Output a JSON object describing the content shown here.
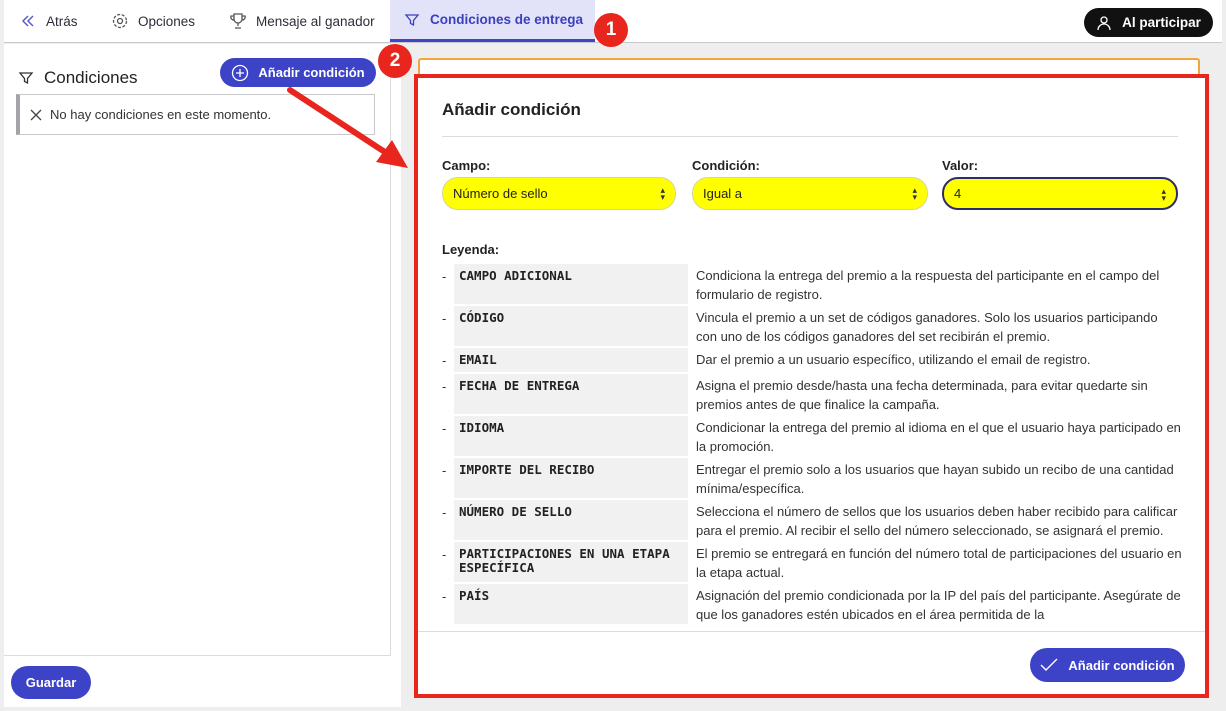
{
  "topbar": {
    "tabs": [
      {
        "label": "Atrás",
        "icon": "chevrons-left-icon"
      },
      {
        "label": "Opciones",
        "icon": "gear-icon"
      },
      {
        "label": "Mensaje al ganador",
        "icon": "trophy-icon"
      },
      {
        "label": "Condiciones de entrega",
        "icon": "filter-icon",
        "active": true
      }
    ],
    "participate_label": "Al participar"
  },
  "badges": {
    "one": "1",
    "two": "2"
  },
  "left": {
    "title": "Condiciones",
    "add_label": "Añadir condición",
    "empty_text": "No hay condiciones en este momento.",
    "save_label": "Guardar"
  },
  "modal": {
    "title": "Añadir condición",
    "campo_label": "Campo:",
    "condicion_label": "Condición:",
    "valor_label": "Valor:",
    "campo_value": "Número de sello",
    "condicion_value": "Igual a",
    "valor_value": "4",
    "legend_label": "Leyenda:",
    "legend": [
      {
        "key": "CAMPO ADICIONAL",
        "desc": "Condiciona la entrega del premio a la respuesta del participante en el campo del formulario de registro."
      },
      {
        "key": "CÓDIGO",
        "desc": "Vincula el premio a un set de códigos ganadores. Solo los usuarios participando con uno de los códigos ganadores del set recibirán el premio."
      },
      {
        "key": "EMAIL",
        "desc": "Dar el premio a un usuario específico, utilizando el email de registro."
      },
      {
        "key": "FECHA DE ENTREGA",
        "desc": "Asigna el premio desde/hasta una fecha determinada, para evitar quedarte sin premios antes de que finalice la campaña."
      },
      {
        "key": "IDIOMA",
        "desc": "Condicionar la entrega del premio al idioma en el que el usuario haya participado en la promoción."
      },
      {
        "key": "IMPORTE DEL RECIBO",
        "desc": "Entregar el premio solo a los usuarios que hayan subido un recibo de una cantidad mínima/específica."
      },
      {
        "key": "NÚMERO DE SELLO",
        "desc": "Selecciona el número de sellos que los usuarios deben haber recibido para calificar para el premio. Al recibir el sello del número seleccionado, se asignará el premio."
      },
      {
        "key": "PARTICIPACIONES EN UNA ETAPA ESPECÍFICA",
        "desc": "El premio se entregará en función del número total de participaciones del usuario en la etapa actual."
      },
      {
        "key": "PAÍS",
        "desc": "Asignación del premio condicionada por la IP del país del participante. Asegúrate de que los ganadores estén ubicados en el área permitida de la"
      }
    ],
    "submit_label": "Añadir condición"
  },
  "colors": {
    "accent": "#3d43c6",
    "highlight": "#ffff00",
    "annotation": "#e8261d"
  }
}
